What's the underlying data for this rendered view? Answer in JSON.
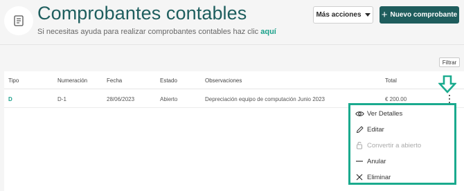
{
  "header": {
    "title": "Comprobantes contables",
    "help_text": "Si necesitas ayuda para realizar comprobantes contables haz clic",
    "help_link": "aquí",
    "more_actions_label": "Más acciones",
    "new_voucher_label": "Nuevo comprobante",
    "new_voucher_icon": "+"
  },
  "filter_label": "Filtrar",
  "table": {
    "columns": [
      "Tipo",
      "Numeración",
      "Fecha",
      "Estado",
      "Observaciones",
      "Total"
    ],
    "rows": [
      {
        "tipo": "D",
        "numeracion": "D-1",
        "fecha": "28/06/2023",
        "estado": "Abierto",
        "observaciones": "Depreciación equipo de computación Junio 2023",
        "total": "€ 200.00"
      }
    ]
  },
  "menu": {
    "items": [
      {
        "label": "Ver Detalles",
        "icon": "eye-icon",
        "enabled": true
      },
      {
        "label": "Editar",
        "icon": "pencil-icon",
        "enabled": true
      },
      {
        "label": "Convertir a abierto",
        "icon": "unlock-icon",
        "enabled": false
      },
      {
        "label": "Anular",
        "icon": "minus-icon",
        "enabled": true
      },
      {
        "label": "Eliminar",
        "icon": "x-icon",
        "enabled": true
      }
    ]
  },
  "colors": {
    "title": "#1e5e5e",
    "accent": "#1aa08a",
    "primary_button": "#1f5d5d",
    "highlight_border": "#1aaa8e"
  }
}
